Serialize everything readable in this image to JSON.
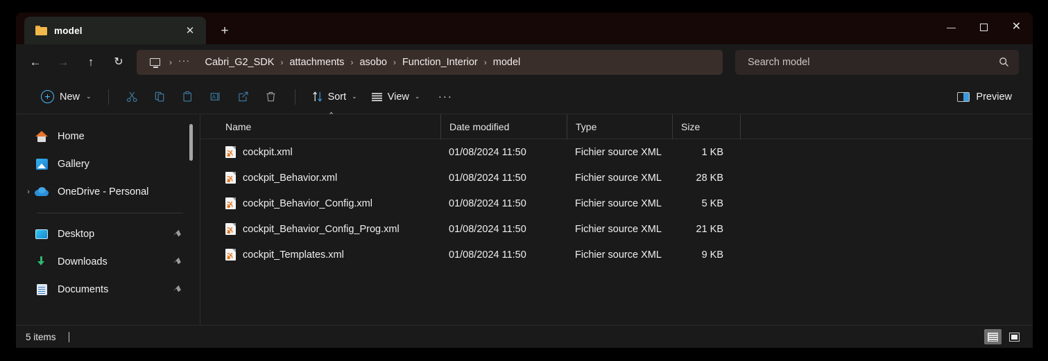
{
  "window": {
    "controls": {
      "minimize_label": "—",
      "maximize_label": "",
      "close_label": "✕"
    }
  },
  "tabs": {
    "items": [
      {
        "label": "model",
        "icon": "folder-icon",
        "close_label": "✕"
      }
    ],
    "new_tab_label": "+"
  },
  "navigation": {
    "back_label": "←",
    "forward_label": "→",
    "up_label": "↑",
    "refresh_label": "↻"
  },
  "breadcrumb": {
    "root_icon": "this-pc-icon",
    "overflow_label": "···",
    "separator": "›",
    "items": [
      "Cabri_G2_SDK",
      "attachments",
      "asobo",
      "Function_Interior",
      "model"
    ]
  },
  "search": {
    "placeholder": "Search model",
    "value": "",
    "icon": "search-icon"
  },
  "toolbar": {
    "new_label": "New",
    "cut_label": "Cut",
    "copy_label": "Copy",
    "paste_label": "Paste",
    "rename_label": "Rename",
    "share_label": "Share",
    "delete_label": "Delete",
    "sort_label": "Sort",
    "view_label": "View",
    "overflow_label": "···",
    "preview_label": "Preview",
    "chevron": "⌄"
  },
  "sidebar": {
    "items": [
      {
        "label": "Home",
        "icon": "home-icon",
        "expandable": false,
        "pinned": false
      },
      {
        "label": "Gallery",
        "icon": "gallery-icon",
        "expandable": false,
        "pinned": false
      },
      {
        "label": "OneDrive - Personal",
        "icon": "onedrive-cloud-icon",
        "expandable": true,
        "pinned": false
      },
      {
        "label": "Desktop",
        "icon": "desktop-icon",
        "expandable": false,
        "pinned": true
      },
      {
        "label": "Downloads",
        "icon": "downloads-icon",
        "expandable": false,
        "pinned": true
      },
      {
        "label": "Documents",
        "icon": "documents-icon",
        "expandable": false,
        "pinned": true
      }
    ],
    "expand_chevron": "›",
    "pin_glyph": "⚑"
  },
  "filelist": {
    "columns": {
      "name": "Name",
      "date_modified": "Date modified",
      "type": "Type",
      "size": "Size"
    },
    "sort_caret": "⌃",
    "rows": [
      {
        "name": "cockpit.xml",
        "date": "01/08/2024 11:50",
        "type": "Fichier source XML",
        "size": "1 KB",
        "icon": "xml-file-icon"
      },
      {
        "name": "cockpit_Behavior.xml",
        "date": "01/08/2024 11:50",
        "type": "Fichier source XML",
        "size": "28 KB",
        "icon": "xml-file-icon"
      },
      {
        "name": "cockpit_Behavior_Config.xml",
        "date": "01/08/2024 11:50",
        "type": "Fichier source XML",
        "size": "5 KB",
        "icon": "xml-file-icon"
      },
      {
        "name": "cockpit_Behavior_Config_Prog.xml",
        "date": "01/08/2024 11:50",
        "type": "Fichier source XML",
        "size": "21 KB",
        "icon": "xml-file-icon"
      },
      {
        "name": "cockpit_Templates.xml",
        "date": "01/08/2024 11:50",
        "type": "Fichier source XML",
        "size": "9 KB",
        "icon": "xml-file-icon"
      }
    ]
  },
  "statusbar": {
    "item_count": "5 items",
    "details_view_label": "Details view",
    "large_icons_view_label": "Large icons view"
  },
  "colors": {
    "accent_blue": "#4db8ff",
    "titlebar_bg": "#150806",
    "addressbar_bg": "#3a2e2b",
    "window_bg": "#1a1a1a",
    "tab_active_bg": "#212420",
    "xml_icon_orange": "#e2761e"
  }
}
